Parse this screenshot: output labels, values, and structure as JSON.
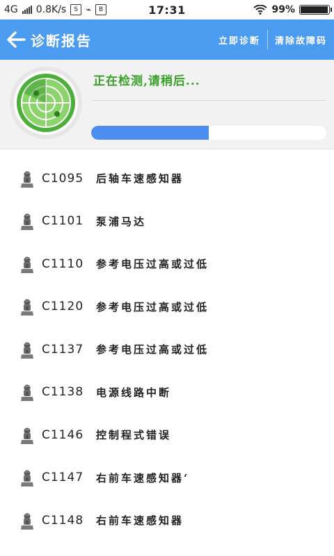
{
  "status_bar": {
    "network": "4G",
    "speed": "0.8K/s",
    "time": "17:31",
    "battery": "99%"
  },
  "app_bar": {
    "title": "诊断报告",
    "action_diagnose": "立即诊断",
    "action_clear": "清除故障码",
    "color": "#4b9bf0"
  },
  "scan": {
    "status_text": "正在检测,请稍后...",
    "progress": 0.5,
    "text_color": "#3aa12a",
    "bar_color": "#4b8ef0"
  },
  "faults": [
    {
      "code": "C1095",
      "desc": "后轴车速感知器"
    },
    {
      "code": "C1101",
      "desc": "泵浦马达"
    },
    {
      "code": "C1110",
      "desc": "参考电压过高或过低"
    },
    {
      "code": "C1120",
      "desc": "参考电压过高或过低"
    },
    {
      "code": "C1137",
      "desc": "参考电压过高或过低"
    },
    {
      "code": "C1138",
      "desc": "电源线路中断"
    },
    {
      "code": "C1146",
      "desc": "控制程式错误"
    },
    {
      "code": "C1147",
      "desc": "右前车速感知器‘"
    },
    {
      "code": "C1148",
      "desc": "右前车速感知器"
    }
  ],
  "icons": {
    "back": "back-arrow-icon",
    "radar": "radar-icon",
    "fault": "car-part-icon"
  }
}
